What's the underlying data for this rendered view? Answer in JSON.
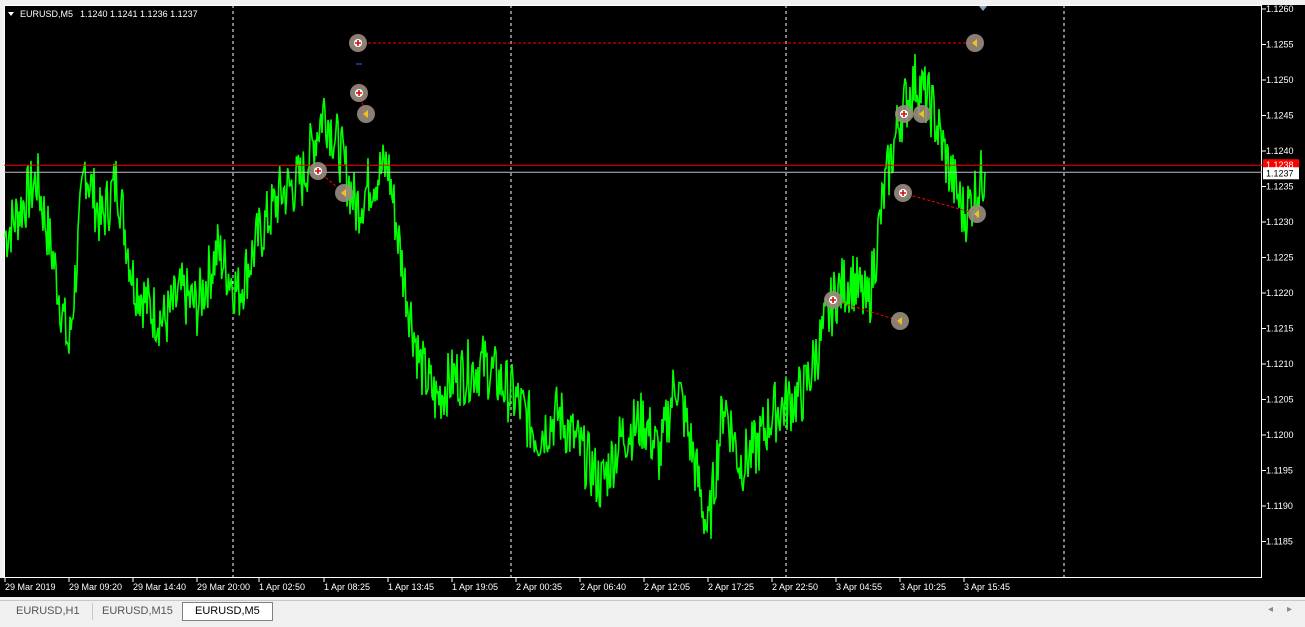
{
  "symbol_header": {
    "symbol": "EURUSD,M5",
    "ohlc": "1.1240 1.1241 1.1236 1.1237"
  },
  "price_axis": {
    "ticks": [
      "1.1260",
      "1.1255",
      "1.1250",
      "1.1245",
      "1.1240",
      "1.1235",
      "1.1230",
      "1.1225",
      "1.1220",
      "1.1215",
      "1.1210",
      "1.1205",
      "1.1200",
      "1.1195",
      "1.1190",
      "1.1185"
    ],
    "ask_label": "1.1238",
    "bid_label": "1.1237"
  },
  "time_axis": {
    "ticks": [
      "29 Mar 2019",
      "29 Mar 09:20",
      "29 Mar 14:40",
      "29 Mar 20:00",
      "1 Apr 02:50",
      "1 Apr 08:25",
      "1 Apr 13:45",
      "1 Apr 19:05",
      "2 Apr 00:35",
      "2 Apr 06:40",
      "2 Apr 12:05",
      "2 Apr 17:25",
      "2 Apr 22:50",
      "3 Apr 04:55",
      "3 Apr 10:25",
      "3 Apr 15:45"
    ]
  },
  "tabs": [
    {
      "label": "EURUSD,H1",
      "active": false
    },
    {
      "label": "EURUSD,M15",
      "active": false
    },
    {
      "label": "EURUSD,M5",
      "active": true
    }
  ],
  "colors": {
    "background": "#000000",
    "price_line": "#00ff00",
    "ask_line": "#ff0000",
    "bid_line": "#c0c0c0",
    "grid": "#ffffff",
    "trade_link": "#ff0000"
  },
  "chart_data": {
    "type": "line",
    "title": "EURUSD,M5",
    "xlabel": "",
    "ylabel": "",
    "ylim": [
      1.1182,
      1.126
    ],
    "x": [
      "29 Mar 2019",
      "29 Mar 04:00",
      "29 Mar 06:40",
      "29 Mar 08:00",
      "29 Mar 09:20",
      "29 Mar 11:00",
      "29 Mar 12:00",
      "29 Mar 13:20",
      "29 Mar 14:40",
      "29 Mar 16:00",
      "29 Mar 17:20",
      "29 Mar 18:40",
      "29 Mar 20:00",
      "29 Mar 21:20",
      "1 Apr 00:00",
      "1 Apr 02:50",
      "1 Apr 05:00",
      "1 Apr 06:40",
      "1 Apr 08:25",
      "1 Apr 09:30",
      "1 Apr 11:00",
      "1 Apr 12:30",
      "1 Apr 13:45",
      "1 Apr 15:00",
      "1 Apr 16:30",
      "1 Apr 17:40",
      "1 Apr 19:05",
      "1 Apr 21:00",
      "2 Apr 00:35",
      "2 Apr 02:30",
      "2 Apr 04:30",
      "2 Apr 06:40",
      "2 Apr 08:30",
      "2 Apr 10:00",
      "2 Apr 12:05",
      "2 Apr 13:30",
      "2 Apr 15:00",
      "2 Apr 16:20",
      "2 Apr 17:25",
      "2 Apr 19:00",
      "2 Apr 20:30",
      "2 Apr 21:40",
      "2 Apr 22:50",
      "3 Apr 01:30",
      "3 Apr 04:55",
      "3 Apr 06:30",
      "3 Apr 08:00",
      "3 Apr 09:20",
      "3 Apr 10:25",
      "3 Apr 12:00",
      "3 Apr 13:30",
      "3 Apr 14:40",
      "3 Apr 15:45",
      "3 Apr 16:20"
    ],
    "series": [
      {
        "values": [
          1.1228,
          1.1232,
          1.1236,
          1.1225,
          1.1212,
          1.1238,
          1.123,
          1.1236,
          1.1222,
          1.1218,
          1.1216,
          1.122,
          1.1218,
          1.1226,
          1.122,
          1.1228,
          1.1234,
          1.1236,
          1.1246,
          1.124,
          1.1232,
          1.1236,
          1.1238,
          1.1222,
          1.121,
          1.1205,
          1.1208,
          1.121,
          1.1205,
          1.12,
          1.1203,
          1.1198,
          1.1193,
          1.12,
          1.1202,
          1.1197,
          1.1208,
          1.1198,
          1.1186,
          1.1205,
          1.1196,
          1.1198,
          1.1203,
          1.1206,
          1.122,
          1.1222,
          1.1218,
          1.1234,
          1.1245,
          1.125,
          1.1246,
          1.1238,
          1.1231,
          1.1237
        ]
      }
    ],
    "horizontal_lines": {
      "ask": 1.1238,
      "bid": 1.1237
    },
    "vertical_separators": [
      "29 Mar 20:00",
      "1 Apr 19:05",
      "2 Apr 22:50",
      "3 Apr 16:20"
    ],
    "trades": [
      {
        "open_time": "1 Apr 08:25",
        "open_price": 1.1255,
        "close_time": "3 Apr 15:45",
        "close_price": 1.1255
      },
      {
        "open_time": "1 Apr 08:25",
        "open_price": 1.1248,
        "close_time": "1 Apr 08:25",
        "close_price": 1.1245
      },
      {
        "open_time": "1 Apr 05:00",
        "open_price": 1.1237,
        "close_time": "1 Apr 06:40",
        "close_price": 1.1234
      },
      {
        "open_time": "3 Apr 09:20",
        "open_price": 1.1245,
        "close_time": "3 Apr 10:25",
        "close_price": 1.1245
      },
      {
        "open_time": "3 Apr 09:20",
        "open_price": 1.1234,
        "close_time": "3 Apr 15:45",
        "close_price": 1.1231
      },
      {
        "open_time": "3 Apr 04:55",
        "open_price": 1.1219,
        "close_time": "3 Apr 08:00",
        "close_price": 1.1216
      }
    ]
  }
}
